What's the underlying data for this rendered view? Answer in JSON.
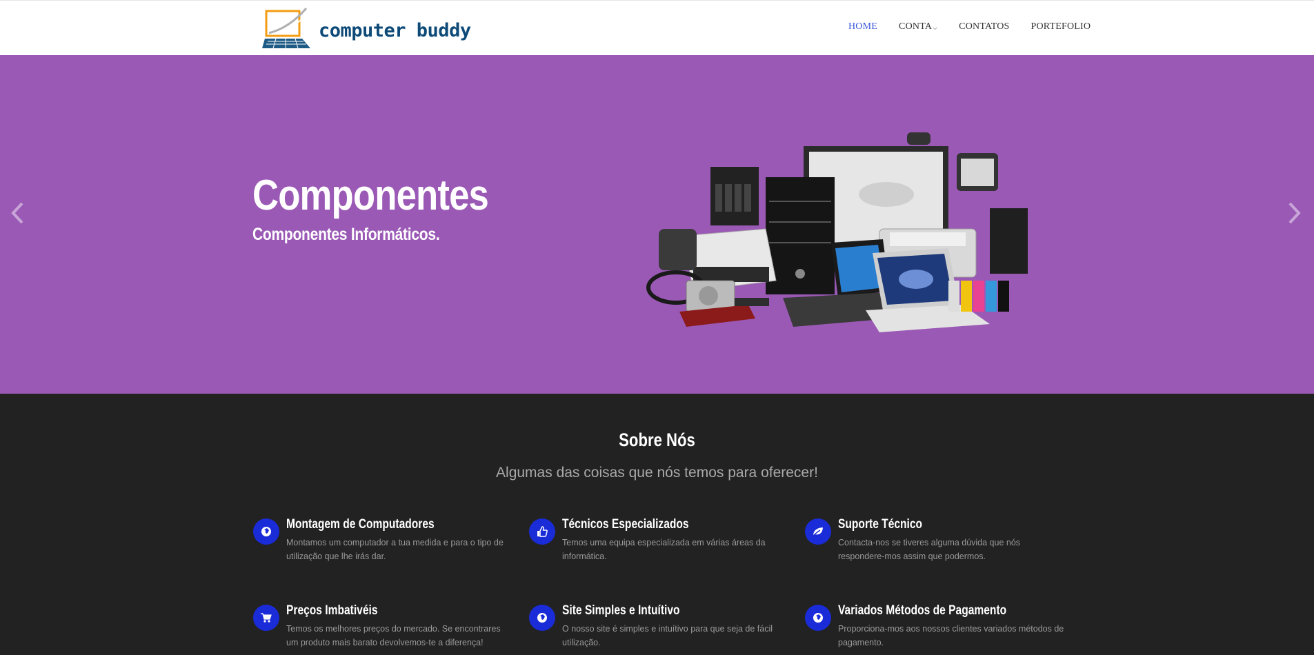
{
  "header": {
    "logo_text": "computer buddy",
    "nav": [
      {
        "label": "HOME",
        "active": true
      },
      {
        "label": "CONTA",
        "dropdown": true
      },
      {
        "label": "CONTATOS"
      },
      {
        "label": "PORTEFOLIO"
      }
    ]
  },
  "hero": {
    "title": "Componentes",
    "subtitle": "Componentes Informáticos.",
    "background_color": "#9b59b6",
    "prev_icon": "chevron-left-icon",
    "next_icon": "chevron-right-icon"
  },
  "about": {
    "title": "Sobre Nós",
    "subtitle": "Algumas das coisas que nós temos para oferecer!",
    "features": [
      {
        "icon": "globe-icon",
        "title": "Montagem de Computadores",
        "desc": "Montamos um computador a tua medida e para o tipo de utilização que lhe irás dar."
      },
      {
        "icon": "thumbs-up-icon",
        "title": "Técnicos Especializados",
        "desc": "Temos uma equipa especializada em várias áreas da informática."
      },
      {
        "icon": "leaf-icon",
        "title": "Suporte Técnico",
        "desc": "Contacta-nos se tiveres alguma dúvida que nós respondere-mos assim que podermos."
      },
      {
        "icon": "cart-icon",
        "title": "Preços Imbativéis",
        "desc": "Temos os melhores preços do mercado. Se encontrares um produto mais barato devolvemos-te a diferença!"
      },
      {
        "icon": "globe-icon",
        "title": "Site Simples e Intuítivo",
        "desc": "O nosso site é simples e intuítivo para que seja de fácil utilização."
      },
      {
        "icon": "globe-icon",
        "title": "Variados Métodos de Pagamento",
        "desc": "Proporciona-mos aos nossos clientes variados métodos de pagamento."
      }
    ],
    "icon_color": "#1a2bd8"
  }
}
